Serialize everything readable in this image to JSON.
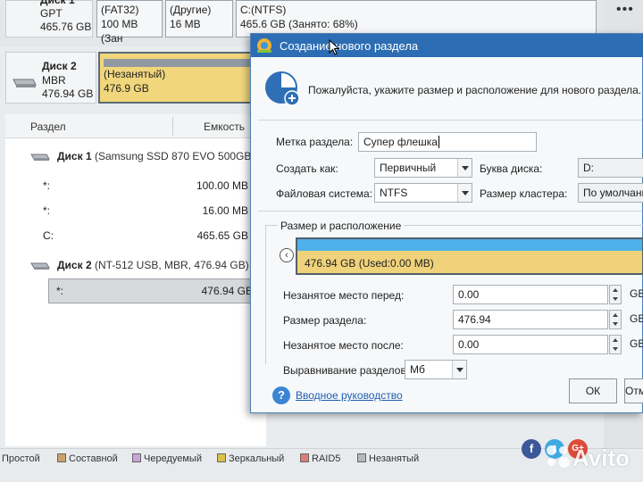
{
  "top_strip": {
    "disk1_name": "Диск 1",
    "disk1_type": "GPT",
    "disk1_size": "465.76 GB",
    "segments": [
      {
        "line1": "(FAT32)",
        "line2": "100 MB (Зан"
      },
      {
        "line1": "(Другие)",
        "line2": "16 MB"
      },
      {
        "line1": "C:(NTFS)",
        "line2": "465.6 GB (Занято: 68%)"
      }
    ],
    "more_label": "•••"
  },
  "disk2_card": {
    "name": "Диск 2",
    "type": "MBR",
    "size": "476.94 GB",
    "unalloc_label": "(Незанятый)",
    "unalloc_size": "476.9 GB"
  },
  "partition_list": {
    "headers": {
      "partition": "Раздел",
      "capacity": "Емкость"
    },
    "disk1_row": {
      "name": "Диск 1",
      "detail": "(Samsung SSD 870 EVO 500GB"
    },
    "disk1_partitions": [
      {
        "name": "*:",
        "size": "100.00 MB"
      },
      {
        "name": "*:",
        "size": "16.00 MB"
      },
      {
        "name": "C:",
        "size": "465.65 GB"
      }
    ],
    "disk2_row": {
      "name": "Диск 2",
      "detail": "(NT-512 USB, MBR, 476.94 GB)"
    },
    "disk2_partitions": [
      {
        "name": "*:",
        "size": "476.94 GB"
      }
    ]
  },
  "legend": [
    {
      "label": "Простой",
      "color": "#4a7fc7"
    },
    {
      "label": "Составной",
      "color": "#c9a26a"
    },
    {
      "label": "Чередуемый",
      "color": "#c7a6d6"
    },
    {
      "label": "Зеркальный",
      "color": "#d9c148"
    },
    {
      "label": "RAID5",
      "color": "#e07a7a"
    },
    {
      "label": "Незанятый",
      "color": "#b8b8b8"
    }
  ],
  "social": {
    "facebook": "f",
    "twitter": "t",
    "googleplus": "G+"
  },
  "watermark": "Avito",
  "dialog": {
    "title": "Создание нового раздела",
    "instruction": "Пожалуйста, укажите размер и расположение для нового раздела.",
    "label_label": "Метка раздела:",
    "label_value": "Супер флешка",
    "create_as_label": "Создать как:",
    "create_as_value": "Первичный",
    "drive_letter_label": "Буква диска:",
    "drive_letter_value": "D:",
    "fs_label": "Файловая система:",
    "fs_value": "NTFS",
    "cluster_label": "Размер кластера:",
    "cluster_value": "По умолчанию",
    "group_title": "Размер и расположение",
    "bar_text": "476.94 GB (Used:0.00 MB)",
    "free_before_label": "Незанятое место перед:",
    "free_before_value": "0.00",
    "partition_size_label": "Размер раздела:",
    "partition_size_value": "476.94",
    "free_after_label": "Незанятое место после:",
    "free_after_value": "0.00",
    "unit": "GB",
    "align_label": "Выравнивание разделов:",
    "align_value": "Мб",
    "help_link": "Вводное руководство",
    "ok_label": "ОК",
    "cancel_label": "Отм"
  }
}
